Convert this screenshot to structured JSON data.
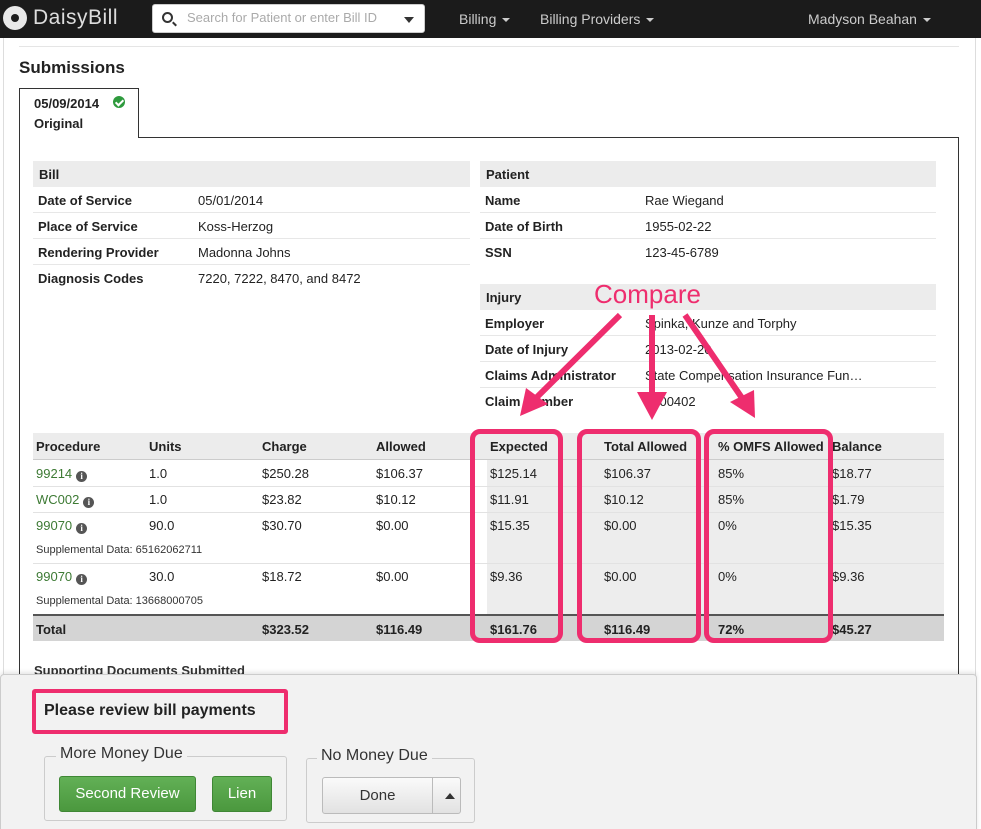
{
  "nav": {
    "logo": "DaisyBill",
    "search_placeholder": "Search for Patient or enter Bill ID",
    "billing": "Billing",
    "billing_providers": "Billing Providers",
    "user": "Madyson Beahan"
  },
  "page": {
    "title": "Submissions"
  },
  "tab": {
    "date": "05/09/2014",
    "type": "Original"
  },
  "bill": {
    "header": "Bill",
    "rows": [
      {
        "key": "Date of Service",
        "value": "05/01/2014"
      },
      {
        "key": "Place of Service",
        "value": "Koss-Herzog"
      },
      {
        "key": "Rendering Provider",
        "value": "Madonna Johns"
      },
      {
        "key": "Diagnosis Codes",
        "value": "7220, 7222, 8470, and 8472"
      }
    ]
  },
  "patient": {
    "header": "Patient",
    "rows": [
      {
        "key": "Name",
        "value": "Rae Wiegand"
      },
      {
        "key": "Date of Birth",
        "value": "1955-02-22"
      },
      {
        "key": "SSN",
        "value": "123-45-6789"
      }
    ]
  },
  "injury": {
    "header": "Injury",
    "rows": [
      {
        "key": "Employer",
        "value": "Spinka, Kunze and Torphy"
      },
      {
        "key": "Date of Injury",
        "value": "2013-02-20"
      },
      {
        "key": "Claims Administrator",
        "value": "State Compensation Insurance Fun…"
      },
      {
        "key": "Claim Number",
        "value": "9300402"
      }
    ]
  },
  "table": {
    "headers": [
      "Procedure",
      "Units",
      "Charge",
      "Allowed",
      "Expected",
      "Total Allowed",
      "% OMFS Allowed",
      "Balance"
    ],
    "rows": [
      {
        "procedure": "99214",
        "units": "1.0",
        "charge": "$250.28",
        "allowed": "$106.37",
        "expected": "$125.14",
        "total_allowed": "$106.37",
        "omfs": "85%",
        "balance": "$18.77",
        "supplemental": ""
      },
      {
        "procedure": "WC002",
        "units": "1.0",
        "charge": "$23.82",
        "allowed": "$10.12",
        "expected": "$11.91",
        "total_allowed": "$10.12",
        "omfs": "85%",
        "balance": "$1.79",
        "supplemental": ""
      },
      {
        "procedure": "99070",
        "units": "90.0",
        "charge": "$30.70",
        "allowed": "$0.00",
        "expected": "$15.35",
        "total_allowed": "$0.00",
        "omfs": "0%",
        "balance": "$15.35",
        "supplemental": "Supplemental Data: 65162062711"
      },
      {
        "procedure": "99070",
        "units": "30.0",
        "charge": "$18.72",
        "allowed": "$0.00",
        "expected": "$9.36",
        "total_allowed": "$0.00",
        "omfs": "0%",
        "balance": "$9.36",
        "supplemental": "Supplemental Data: 13668000705"
      }
    ],
    "total": {
      "label": "Total",
      "charge": "$323.52",
      "allowed": "$116.49",
      "expected": "$161.76",
      "total_allowed": "$116.49",
      "omfs": "72%",
      "balance": "$45.27"
    }
  },
  "supporting_docs": "Supporting Documents Submitted",
  "review": {
    "title": "Please review bill payments",
    "more_money_due": "More Money Due",
    "second_review": "Second Review",
    "lien": "Lien",
    "no_money_due": "No Money Due",
    "done": "Done"
  },
  "annotation": {
    "compare": "Compare",
    "color": "#ee2d6e"
  }
}
